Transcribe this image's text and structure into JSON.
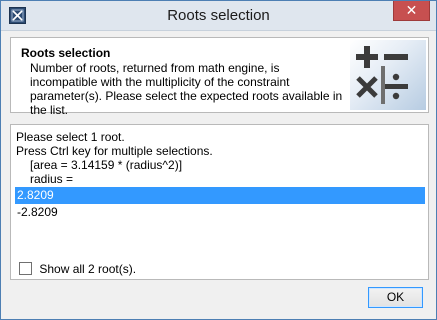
{
  "window": {
    "title": "Roots selection",
    "close_glyph": "✕"
  },
  "header": {
    "title": "Roots selection",
    "message": "Number of roots, returned from math engine, is incompatible with the multiplicity of the constraint parameter(s). Please select the expected roots available in the list.",
    "logo_icon": "math-operators-icon"
  },
  "instructions": {
    "line1": "Please select 1 root.",
    "line2": "Press Ctrl key for multiple selections.",
    "line3": "[area = 3.14159 * (radius^2)]",
    "line4": "radius ="
  },
  "roots": {
    "items": [
      {
        "value": "2.8209",
        "selected": true
      },
      {
        "value": "-2.8209",
        "selected": false
      }
    ]
  },
  "options": {
    "show_all_label": "Show all 2 root(s).",
    "show_all_checked": false
  },
  "buttons": {
    "ok_label": "OK"
  },
  "colors": {
    "selection": "#3399ff",
    "close_button": "#c75050",
    "titlebar": "#dfe6ee"
  }
}
